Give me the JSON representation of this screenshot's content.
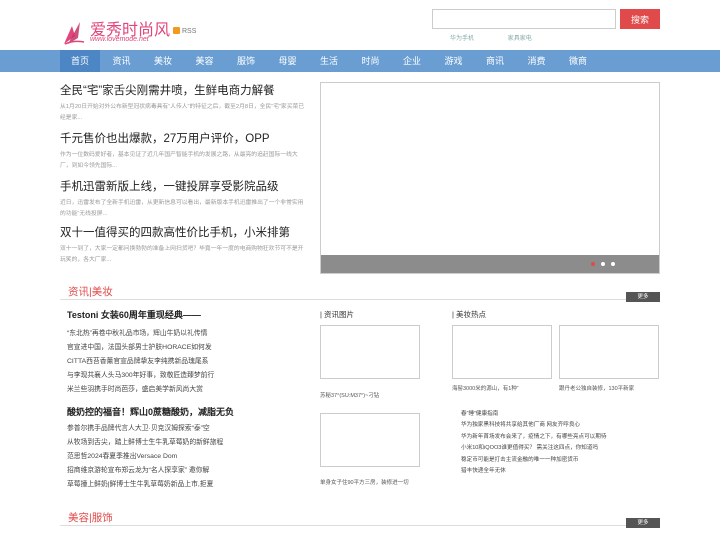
{
  "header": {
    "logo_text": "爱秀时尚风",
    "logo_url": "www.lovemode.net",
    "rss_label": "RSS",
    "search_placeholder": "",
    "search_button": "搜索",
    "hot_links": [
      "华为手机",
      "家具家电"
    ],
    "brand_color": "#e0457b"
  },
  "nav": {
    "items": [
      "首页",
      "资讯",
      "美妆",
      "美容",
      "服饰",
      "母婴",
      "生活",
      "时尚",
      "企业",
      "游戏",
      "商讯",
      "消费",
      "微商"
    ],
    "active_index": 0,
    "color": "#6a9ed3"
  },
  "headlines": [
    {
      "title": "全民“宅”家舌尖刚需井喷，生鲜电商力解餐",
      "desc": "从1月20日开始对外公布新型冠状病毒具有“人传人”的特征之后，截至2月8日，全民“宅”家买菜已经是家..."
    },
    {
      "title": "千元售价也出爆款，27万用户评价，OPP",
      "desc": "作为一位数码爱好者，基本见证了近几年国产智能手机的发展之路，从最亮的追赶国际一线大厂，到如今领先国际..."
    },
    {
      "title": "手机迅雷新版上线，一键投屏享受影院品级",
      "desc": "近日，迅雷发布了全新手机迅雷，从更新信息可以看出，最新版本手机迅雷推出了一个非常实用的功能“无线投屏..."
    },
    {
      "title": "双十一值得买的四款高性价比手机，小米排第",
      "desc": "双十一到了，大家一定都问换勃勃的准备上网扫货吧？毕竟一年一度的电商购物狂欢节可不是开玩笑的，各大厂家..."
    }
  ],
  "slider": {
    "dots": 3,
    "active_dot": 0
  },
  "section1": {
    "title": "资讯|美妆",
    "more": "更多",
    "col1": {
      "blocks": [
        {
          "title": "Testoni 女装60周年重现经典——",
          "items": [
            "“东北热”再卷中秋礼品市场，辉山牛奶以礼传情",
            "官宣进中国，法国头部男士护肤HORACE如何发",
            "CITTA西苔香薰官宣品牌挚友李纯携新品瑰尾系",
            "与李现共襄人头马300年好事，致敬匠造臻梦前行",
            "米兰些羽携手时尚芭莎，盛启美学新风尚大赏"
          ]
        },
        {
          "title": "酸奶控的福音！辉山0蔗糖酸奶，减脂无负",
          "items": [
            "参普尔携手品牌代言人大卫·贝克汉姆探索“泰”空",
            "从牧场到舌尖，踏上鲜博士生牛乳草莓奶的新鲜旅程",
            "范思哲2024春夏季推出Versace Dom",
            "招商维京游轮宣布郑云龙为“名人探享家” 邀你解",
            "草莓撞上鲜奶|鲜博士生牛乳草莓奶新品上市,拒夏"
          ]
        }
      ]
    },
    "col2": {
      "title": "| 资讯图片",
      "captions": [
        "苏秘37°(SU:M37°)~刁钻",
        "",
        "单身女子住90平方三房，装修进一切",
        ""
      ]
    },
    "col3": {
      "title": "| 美妆热点",
      "captions": [
        "海髻3000米的源山，有1种“",
        "跟丹老公独自装修，130平新家"
      ],
      "list": [
        "春“睡”健康指南",
        "华为独家黑科技将共享给其他厂商 网友齐呼良心",
        "华为新年首场发布会来了，疫情之下，有哪些亮点可以期待",
        "小米10和iQOO3谁更值得买？ 需关注这四点，你知道吗",
        "稳定币可能是打击主流金融的唯一一种加密货币",
        "猎丰快递全年无休"
      ]
    }
  },
  "section2": {
    "title": "美容|服饰",
    "more": "更多"
  }
}
